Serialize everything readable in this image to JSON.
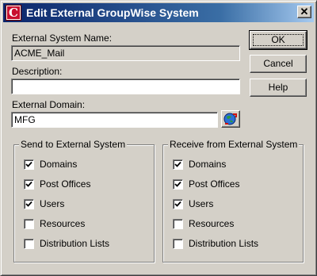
{
  "window": {
    "title": "Edit External GroupWise System",
    "app_icon_letter": "C"
  },
  "form": {
    "system_name_label": "External System Name:",
    "system_name_value": "ACME_Mail",
    "description_label": "Description:",
    "description_value": "",
    "domain_label": "External Domain:",
    "domain_value": "MFG"
  },
  "buttons": {
    "ok": "OK",
    "cancel": "Cancel",
    "help": "Help"
  },
  "send_group": {
    "title": "Send to External System",
    "items": [
      {
        "label": "Domains",
        "checked": true
      },
      {
        "label": "Post Offices",
        "checked": true
      },
      {
        "label": "Users",
        "checked": true
      },
      {
        "label": "Resources",
        "checked": false
      },
      {
        "label": "Distribution Lists",
        "checked": false
      }
    ]
  },
  "receive_group": {
    "title": "Receive from External System",
    "items": [
      {
        "label": "Domains",
        "checked": true
      },
      {
        "label": "Post Offices",
        "checked": true
      },
      {
        "label": "Users",
        "checked": true
      },
      {
        "label": "Resources",
        "checked": false
      },
      {
        "label": "Distribution Lists",
        "checked": false
      }
    ]
  },
  "icons": {
    "app": "groupwise-app-icon",
    "close": "close-icon",
    "browse": "globe-browse-icon"
  },
  "colors": {
    "titlebar_start": "#0a246a",
    "titlebar_end": "#a6caf0",
    "face": "#d4d0c8",
    "app_icon_red": "#c8102e"
  }
}
